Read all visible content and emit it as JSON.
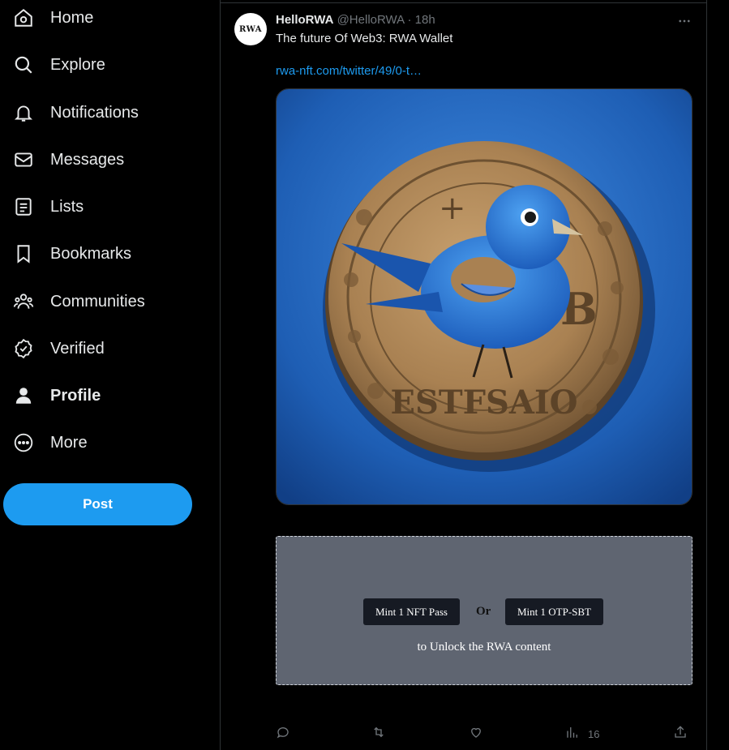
{
  "sidebar": {
    "items": [
      {
        "label": "Home",
        "icon": "home-icon"
      },
      {
        "label": "Explore",
        "icon": "search-icon"
      },
      {
        "label": "Notifications",
        "icon": "bell-icon"
      },
      {
        "label": "Messages",
        "icon": "envelope-icon"
      },
      {
        "label": "Lists",
        "icon": "list-icon"
      },
      {
        "label": "Bookmarks",
        "icon": "bookmark-icon"
      },
      {
        "label": "Communities",
        "icon": "people-icon"
      },
      {
        "label": "Verified",
        "icon": "verified-badge-icon"
      },
      {
        "label": "Profile",
        "icon": "person-icon"
      },
      {
        "label": "More",
        "icon": "more-circle-icon"
      }
    ],
    "post_label": "Post"
  },
  "tweet": {
    "avatar_text": "RWA",
    "display_name": "HelloRWA",
    "handle": "@HelloRWA",
    "separator": "·",
    "time": "18h",
    "text": "The future Of Web3: RWA Wallet",
    "link": "rwa-nft.com/twitter/49/0-t…",
    "image_alt": "blue-bird-on-gold-coin-image",
    "locked": {
      "mint_nft_label": "Mint 1 NFT Pass",
      "or_label": "Or",
      "mint_sbt_label": "Mint 1 OTP-SBT",
      "unlock_text": "to Unlock the RWA content"
    },
    "actions": {
      "reply_count": "",
      "retweet_count": "",
      "like_count": "",
      "views_count": "16"
    }
  },
  "colors": {
    "accent": "#1d9bf0",
    "background": "#000000",
    "locked_bg": "#5f6571",
    "mint_button": "#161a23"
  }
}
